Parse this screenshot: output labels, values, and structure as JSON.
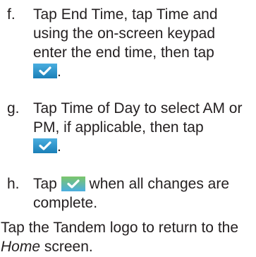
{
  "document": {
    "steps": [
      {
        "letter": "f.",
        "t1": "Tap ",
        "t2": "End Time",
        "t3": ", tap ",
        "t4": "Time",
        "t5": " and using the on-screen keypad enter the end time, then tap",
        "icon": "checkmark-button-icon",
        "after": "."
      },
      {
        "letter": "g.",
        "t1": "Tap ",
        "t2": "Time of Day",
        "t3": " to select AM or PM, if applicable, then tap",
        "icon": "checkmark-button-icon",
        "after": "."
      },
      {
        "letter": "h.",
        "t1": "Tap ",
        "icon": "checkmark-button-icon",
        "t2": " when all changes are complete."
      }
    ],
    "closing": {
      "t1": "Tap the ",
      "t2": "Tandem logo",
      "t3": " to return to the ",
      "t4": "Home",
      "t5": " screen."
    }
  },
  "colors": {
    "text": "#231f20",
    "button_fill": "#1a7fb7",
    "button_fill_light": "#4aaee0",
    "check": "#ffffff"
  }
}
